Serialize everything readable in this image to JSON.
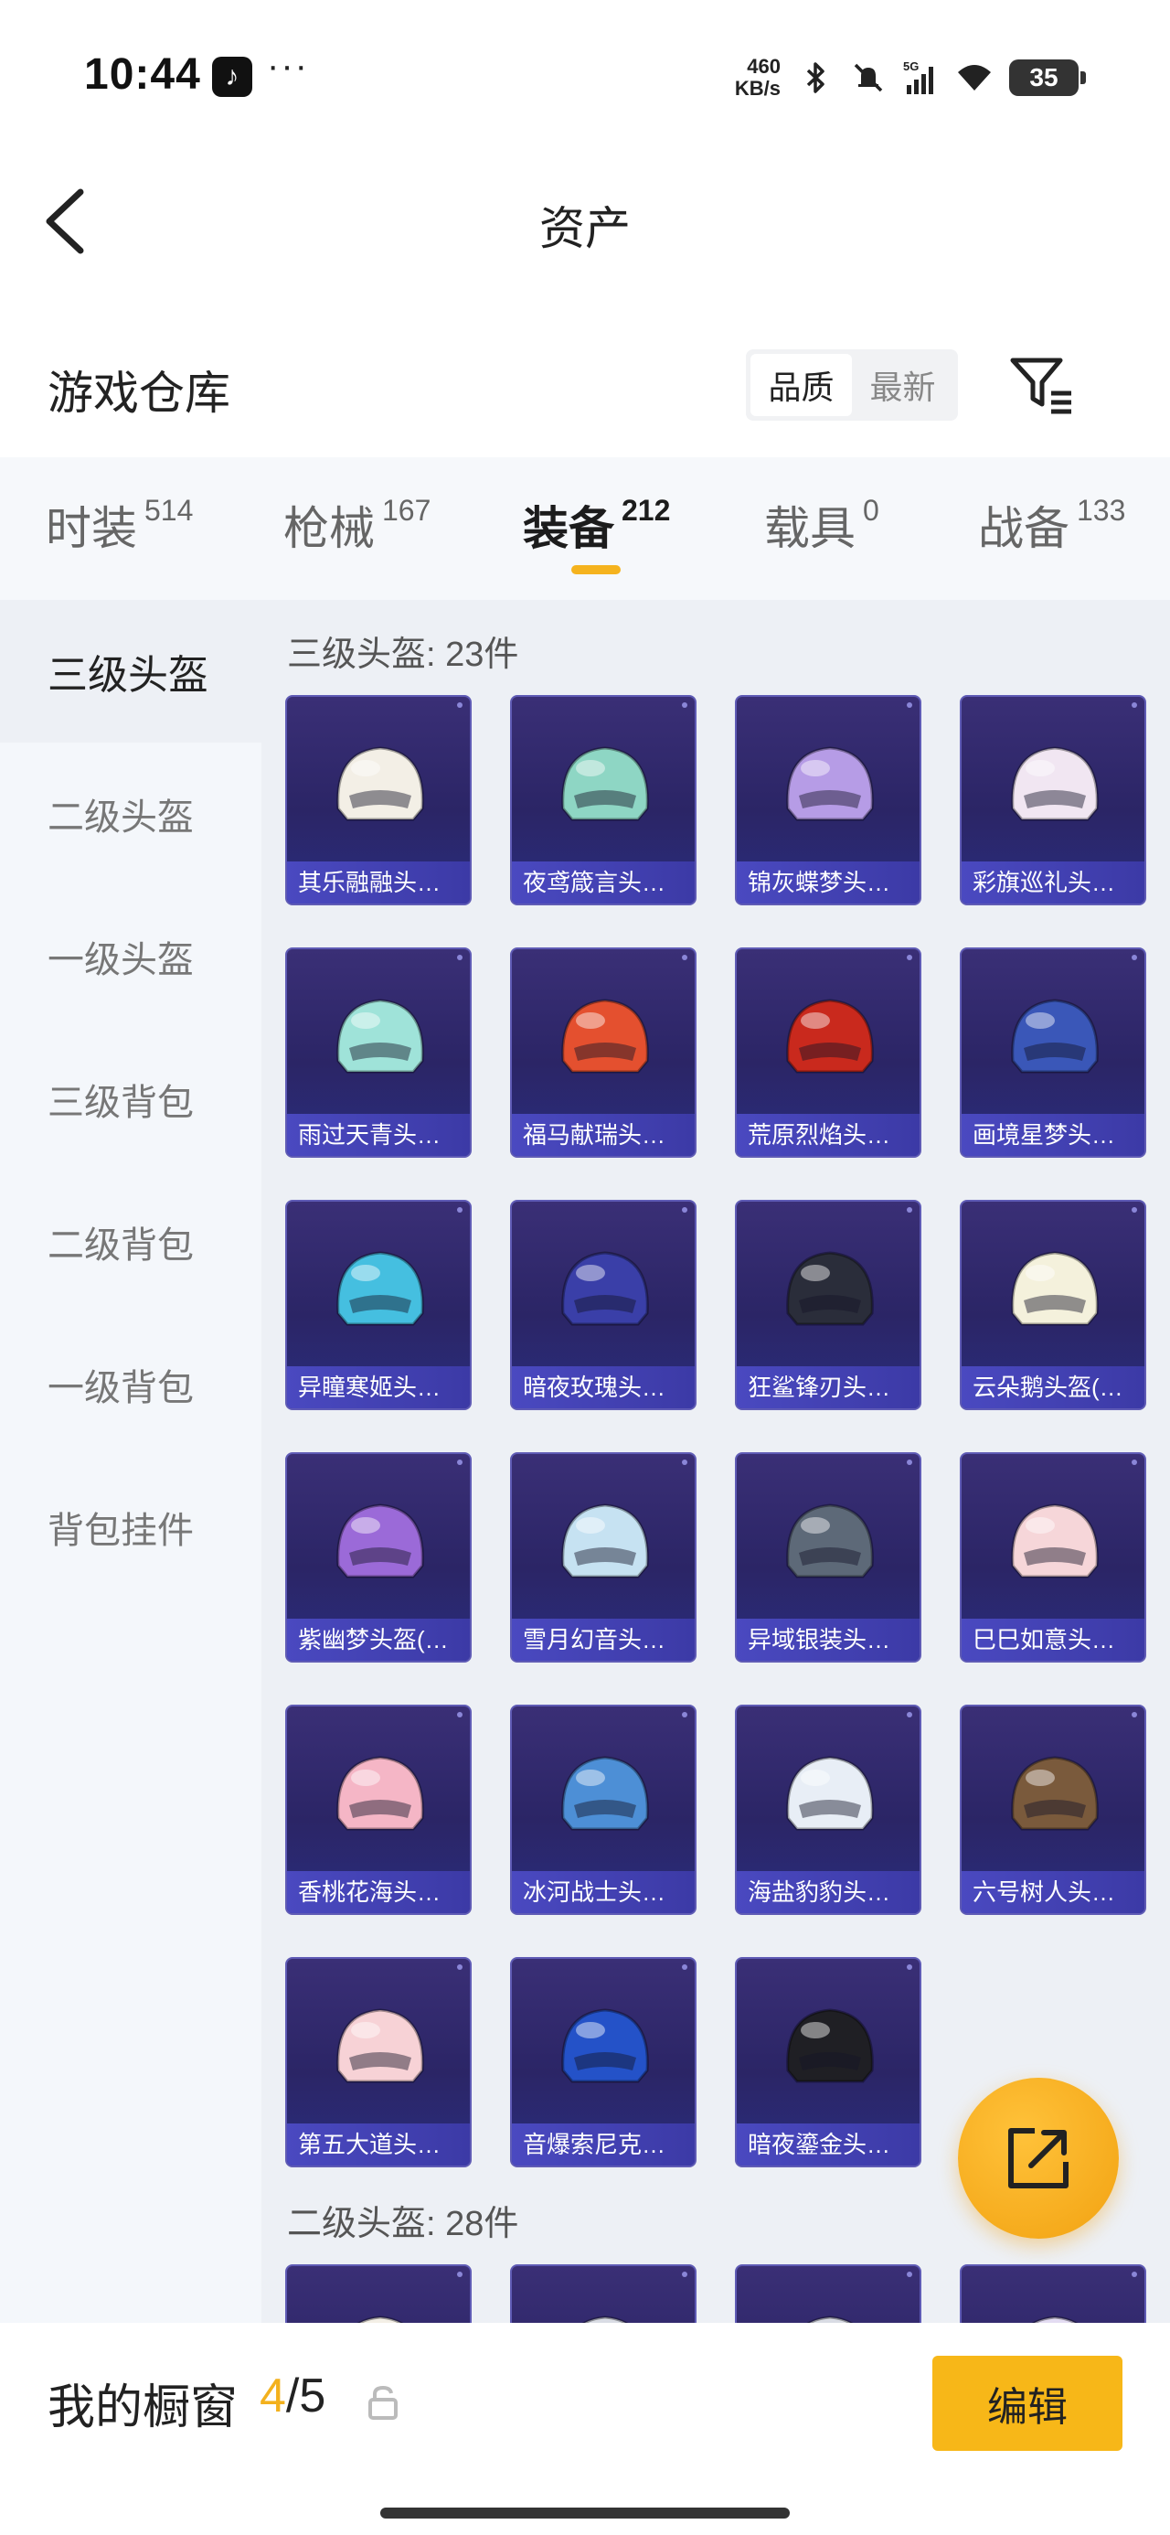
{
  "status_bar": {
    "time": "10:44",
    "dots": "···",
    "net_speed_value": "460",
    "net_speed_unit": "KB/s",
    "network": "5G",
    "battery": "35"
  },
  "header": {
    "title": "资产"
  },
  "warehouse": {
    "title": "游戏仓库",
    "sort_options": [
      "品质",
      "最新"
    ],
    "active_sort": "品质"
  },
  "categories": [
    {
      "name": "时装",
      "count": "514",
      "active": false
    },
    {
      "name": "枪械",
      "count": "167",
      "active": false
    },
    {
      "name": "装备",
      "count": "212",
      "active": true
    },
    {
      "name": "载具",
      "count": "0",
      "active": false
    },
    {
      "name": "战备",
      "count": "133",
      "active": false
    }
  ],
  "sidebar": [
    {
      "label": "三级头盔",
      "active": true
    },
    {
      "label": "二级头盔",
      "active": false
    },
    {
      "label": "一级头盔",
      "active": false
    },
    {
      "label": "三级背包",
      "active": false
    },
    {
      "label": "二级背包",
      "active": false
    },
    {
      "label": "一级背包",
      "active": false
    },
    {
      "label": "背包挂件",
      "active": false
    }
  ],
  "groups": [
    {
      "title": "三级头盔: 23件",
      "items": [
        {
          "name": "其乐融融头…",
          "color": "#f3efe6"
        },
        {
          "name": "夜鸢箴言头…",
          "color": "#8ed6c4"
        },
        {
          "name": "锦灰蝶梦头…",
          "color": "#b69ce6"
        },
        {
          "name": "彩旗巡礼头…",
          "color": "#f1e6f2"
        },
        {
          "name": "雨过天青头…",
          "color": "#9fe3d9"
        },
        {
          "name": "福马献瑞头…",
          "color": "#e4502f"
        },
        {
          "name": "荒原烈焰头…",
          "color": "#c9291d"
        },
        {
          "name": "画境星梦头…",
          "color": "#3a57b8"
        },
        {
          "name": "异瞳寒姬头…",
          "color": "#45bfe0"
        },
        {
          "name": "暗夜玫瑰头…",
          "color": "#3a3fa8"
        },
        {
          "name": "狂鲨锋刃头…",
          "color": "#2a2d3a"
        },
        {
          "name": "云朵鹅头盔(…",
          "color": "#f4f1dc"
        },
        {
          "name": "紫幽梦头盔(…",
          "color": "#9b6ad8"
        },
        {
          "name": "雪月幻音头…",
          "color": "#c6e2f2"
        },
        {
          "name": "异域银装头…",
          "color": "#5d6978"
        },
        {
          "name": "巳巳如意头…",
          "color": "#f6d6d9"
        },
        {
          "name": "香桃花海头…",
          "color": "#f5b6c6"
        },
        {
          "name": "冰河战士头…",
          "color": "#4d8fd6"
        },
        {
          "name": "海盐豹豹头…",
          "color": "#e8eef6"
        },
        {
          "name": "六号树人头…",
          "color": "#7a5a3c"
        },
        {
          "name": "第五大道头…",
          "color": "#f7d2d6"
        },
        {
          "name": "音爆索尼克…",
          "color": "#2452c8"
        },
        {
          "name": "暗夜鎏金头…",
          "color": "#1f1f24"
        }
      ]
    },
    {
      "title": "二级头盔: 28件",
      "items": [
        {
          "name": "",
          "color": "#f3efe6"
        },
        {
          "name": "",
          "color": "#d9dce4"
        },
        {
          "name": "",
          "color": "#d9dce4"
        },
        {
          "name": "",
          "color": "#e3dcf2"
        }
      ]
    }
  ],
  "showcase": {
    "label": "我的橱窗",
    "current": "4",
    "separator": "/",
    "total": "5",
    "edit_label": "编辑"
  }
}
